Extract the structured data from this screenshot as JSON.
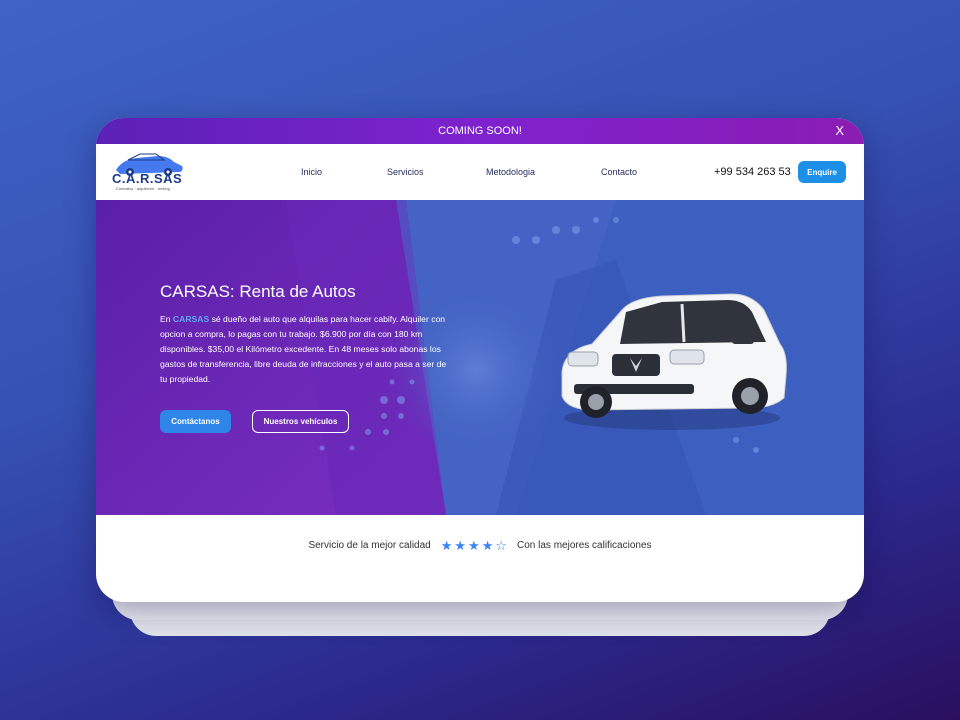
{
  "banner": {
    "text": "COMING SOON!",
    "close_label": "X"
  },
  "brand": {
    "name": "C.A.R.SAS",
    "tagline": "Contratos · alquileres · renting"
  },
  "nav": {
    "items": [
      {
        "label": "Inicio"
      },
      {
        "label": "Servicios"
      },
      {
        "label": "Metodologia"
      },
      {
        "label": "Contacto"
      }
    ],
    "phone": "+99 534 263 53",
    "cta": "Enquire"
  },
  "hero": {
    "title": "CARSAS: Renta de Autos",
    "text_prefix": "En ",
    "brand_word": "CARSAS",
    "text_body": " sé dueño del auto que alquilas para hacer cabify. Alquiler con opcion a compra, lo pagas con tu trabajo. $6.900 por día con 180 km disponibles. $35,00 el Kilómetro excedente. En 48 meses solo abonas los gastos de transferencia, libre deuda de infracciones y el auto pasa a ser de tu propiedad.",
    "primary_button": "Contáctanos",
    "secondary_button": "Nuestros vehículos"
  },
  "rating_bar": {
    "left_text": "Servicio de la mejor calidad",
    "stars_value": 4,
    "stars_max": 5,
    "right_text": "Con las mejores calificaciones"
  },
  "colors": {
    "accent": "#2f86e8",
    "banner_purple": "#7e22ce",
    "hero_blue": "#3c5fc0"
  }
}
